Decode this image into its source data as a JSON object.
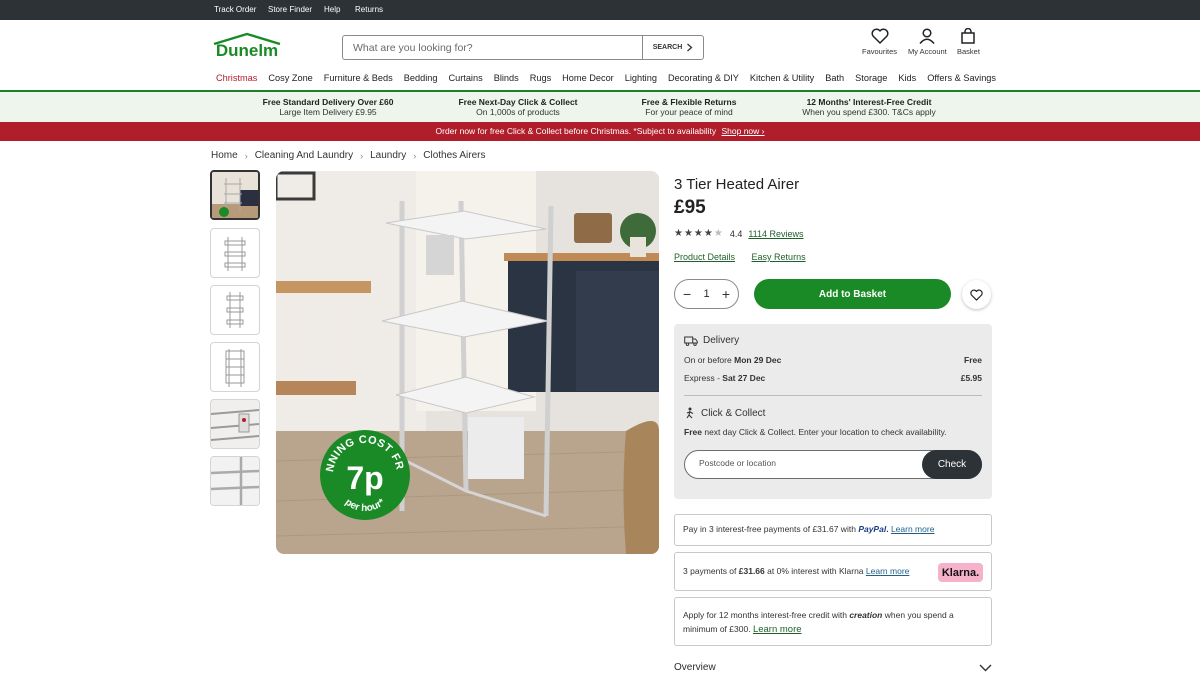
{
  "utility": [
    "Track Order",
    "Store Finder",
    "Help",
    "Returns"
  ],
  "header": {
    "logo": "Dunelm",
    "search_placeholder": "What are you looking for?",
    "search_button": "SEARCH",
    "favourites": "Favourites",
    "account": "My Account",
    "basket": "Basket"
  },
  "categories": [
    "Christmas",
    "Cosy Zone",
    "Furniture & Beds",
    "Bedding",
    "Curtains",
    "Blinds",
    "Rugs",
    "Home Decor",
    "Lighting",
    "Decorating & DIY",
    "Kitchen & Utility",
    "Bath",
    "Storage",
    "Kids",
    "Offers & Savings"
  ],
  "usps": [
    {
      "title": "Free Standard Delivery Over £60",
      "sub": "Large Item Delivery £9.95"
    },
    {
      "title": "Free Next-Day Click & Collect",
      "sub": "On 1,000s of products"
    },
    {
      "title": "Free & Flexible Returns",
      "sub": "For your peace of mind"
    },
    {
      "title": "12 Months' Interest-Free Credit",
      "sub": "When you spend £300. T&Cs apply"
    }
  ],
  "promo": {
    "text": "Order now for free Click & Collect before Christmas. *Subject to availability",
    "link": "Shop now ›"
  },
  "breadcrumb": [
    "Home",
    "Cleaning And Laundry",
    "Laundry",
    "Clothes Airers"
  ],
  "badge": {
    "top": "RUNNING COST FROM",
    "value": "7p",
    "bottom": "per hour*"
  },
  "product": {
    "title": "3 Tier Heated Airer",
    "price": "£95",
    "rating": "4.4",
    "rating_stars": 4.4,
    "reviews": "1114 Reviews",
    "link_details": "Product Details",
    "link_returns": "Easy Returns",
    "quantity": "1",
    "add_to_basket": "Add to Basket"
  },
  "delivery": {
    "heading": "Delivery",
    "std_label_pre": "On or before",
    "std_date": "Mon 29 Dec",
    "std_price": "Free",
    "exp_label": "Express -",
    "exp_date": "Sat 27 Dec",
    "exp_price": "£5.95",
    "cc_heading": "Click & Collect",
    "cc_free": "Free",
    "cc_text": "next day Click & Collect. Enter your location to check availability.",
    "postcode_placeholder": "Postcode or location",
    "check": "Check"
  },
  "paypal": {
    "text": "Pay in 3 interest-free payments of £31.67 with",
    "brand": "PayPal",
    "link": "Learn more"
  },
  "klarna": {
    "pre": "3 payments of",
    "amount": "£31.66",
    "post": "at 0% interest with Klarna",
    "link": "Learn more",
    "brand": "Klarna."
  },
  "creation": {
    "pre": "Apply for 12 months interest-free credit with",
    "brand": "creation",
    "post": "when you spend a minimum of £300.",
    "link": "Learn more"
  },
  "overview": "Overview",
  "colors": {
    "brand_green": "#1a8a26",
    "promo_red": "#b01e2c",
    "utility_bg": "#2c3236"
  }
}
